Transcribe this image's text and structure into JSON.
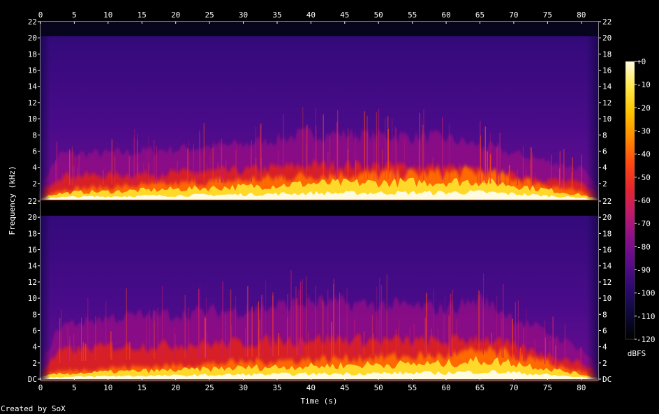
{
  "chart_data": {
    "type": "heatmap",
    "title": "",
    "xlabel": "Time (s)",
    "ylabel": "Frequency (kHz)",
    "xlim": [
      0,
      82.5
    ],
    "ylim": [
      0,
      22
    ],
    "x_ticks": [
      0,
      5,
      10,
      15,
      20,
      25,
      30,
      35,
      40,
      45,
      50,
      55,
      60,
      65,
      70,
      75,
      80
    ],
    "y_ticks": [
      2,
      4,
      6,
      8,
      10,
      12,
      14,
      16,
      18,
      20,
      22
    ],
    "y_zero_label": "DC",
    "channels": [
      {
        "envelope_kHz": [
          [
            0,
            0.2
          ],
          [
            2,
            0.7
          ],
          [
            5,
            0.9
          ],
          [
            10,
            1.0
          ],
          [
            20,
            1.3
          ],
          [
            30,
            1.6
          ],
          [
            40,
            2.0
          ],
          [
            50,
            2.1
          ],
          [
            60,
            2.2
          ],
          [
            65,
            2.3
          ],
          [
            70,
            1.8
          ],
          [
            75,
            1.2
          ],
          [
            80,
            0.6
          ],
          [
            82,
            0.2
          ]
        ],
        "red_band_kHz": [
          [
            0,
            1.0
          ],
          [
            3,
            3.0
          ],
          [
            10,
            3.0
          ],
          [
            30,
            3.6
          ],
          [
            40,
            4.3
          ],
          [
            50,
            4.2
          ],
          [
            60,
            4.0
          ],
          [
            70,
            3.0
          ],
          [
            80,
            2.0
          ],
          [
            82,
            1.0
          ]
        ]
      },
      {
        "envelope_kHz": [
          [
            0,
            0.2
          ],
          [
            2,
            0.6
          ],
          [
            5,
            0.7
          ],
          [
            10,
            0.9
          ],
          [
            20,
            1.1
          ],
          [
            30,
            1.4
          ],
          [
            40,
            1.6
          ],
          [
            50,
            1.8
          ],
          [
            60,
            1.9
          ],
          [
            65,
            2.3
          ],
          [
            70,
            2.0
          ],
          [
            75,
            1.3
          ],
          [
            80,
            0.6
          ],
          [
            82,
            0.2
          ]
        ],
        "red_band_kHz": [
          [
            0,
            1.0
          ],
          [
            3,
            3.5
          ],
          [
            10,
            4.0
          ],
          [
            30,
            4.5
          ],
          [
            40,
            5.0
          ],
          [
            50,
            4.8
          ],
          [
            60,
            4.6
          ],
          [
            65,
            5.2
          ],
          [
            70,
            4.0
          ],
          [
            80,
            2.0
          ],
          [
            82,
            1.0
          ]
        ]
      }
    ],
    "colorbar": {
      "label": "dBFS",
      "ticks": [
        "+0",
        "-10",
        "-20",
        "-30",
        "-40",
        "-50",
        "-60",
        "-70",
        "-80",
        "-90",
        "-100",
        "-110",
        "-120"
      ],
      "range": [
        -120,
        0
      ],
      "colors": [
        "#000000",
        "#0c0a38",
        "#2a0a6e",
        "#5a0b8c",
        "#8a0f8a",
        "#c01a6a",
        "#e6262e",
        "#ff4a10",
        "#ff8c00",
        "#ffc400",
        "#ffe94a",
        "#fffbe0"
      ]
    },
    "credit": "Created by SoX"
  }
}
